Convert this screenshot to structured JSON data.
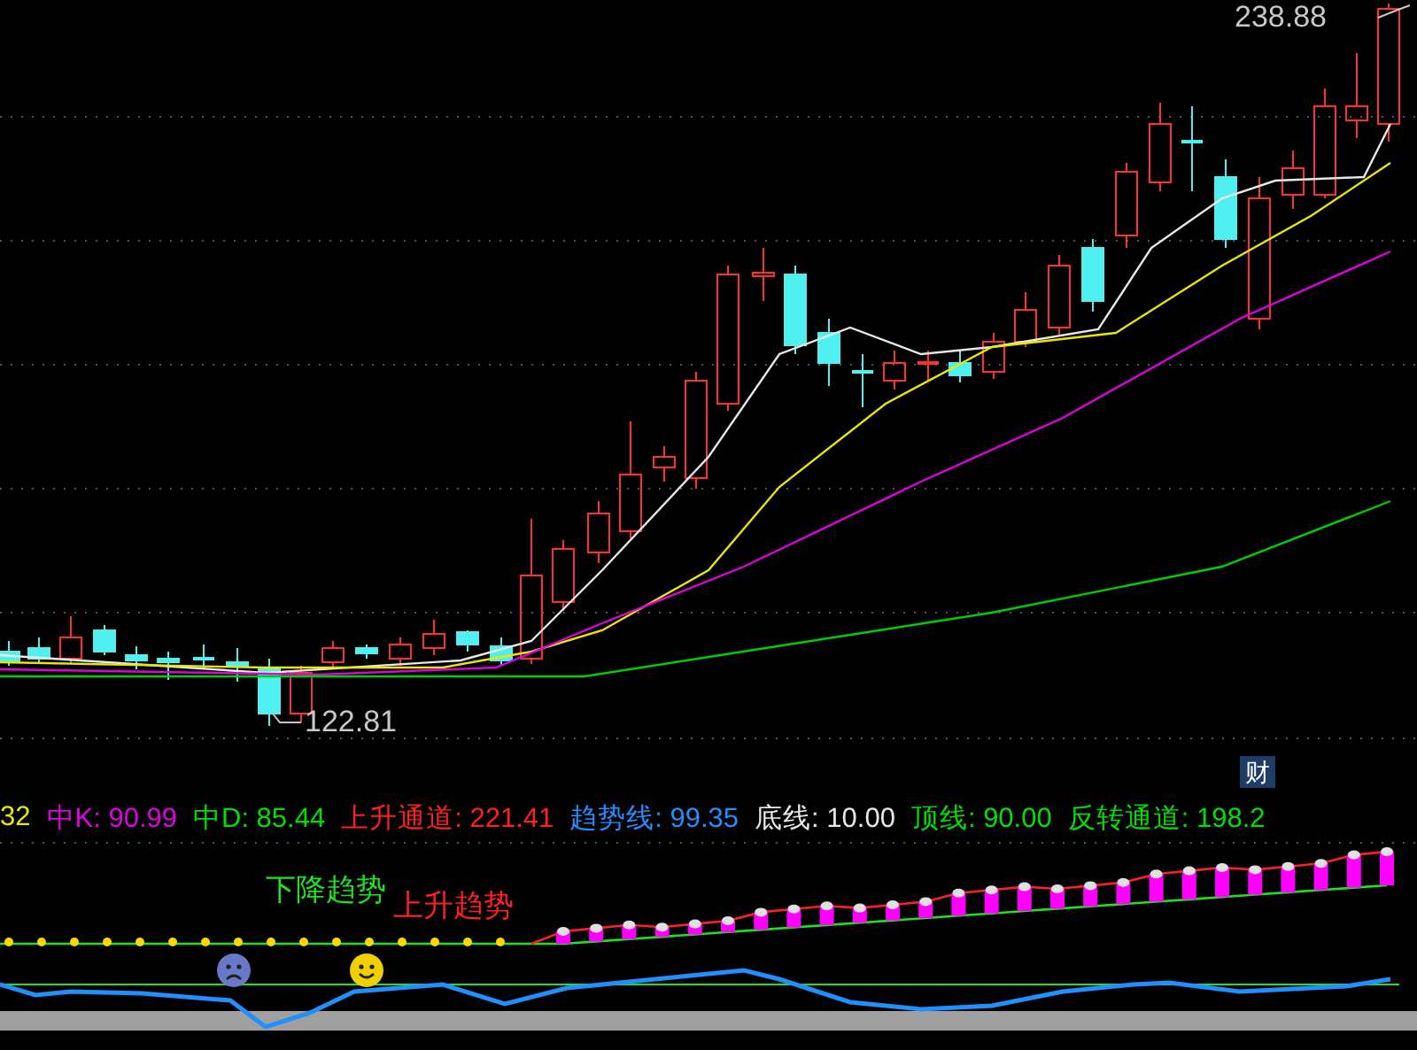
{
  "price_labels": {
    "high": "238.88",
    "low": "122.81"
  },
  "badge": "财",
  "legend": [
    {
      "text": "32",
      "color": "#e8e800"
    },
    {
      "text": "中K: 90.99",
      "color": "#e000e0"
    },
    {
      "text": "中D: 85.44",
      "color": "#00e000"
    },
    {
      "text": "上升通道: 221.41",
      "color": "#ff2020"
    },
    {
      "text": "趋势线: 99.35",
      "color": "#2090ff"
    },
    {
      "text": "底线: 10.00",
      "color": "#e8e8e8"
    },
    {
      "text": "顶线: 90.00",
      "color": "#00e000"
    },
    {
      "text": "反转通道: 198.2",
      "color": "#00e000"
    }
  ],
  "signals": [
    {
      "text": "下降趋势",
      "kind": "down"
    },
    {
      "text": "上升趋势",
      "kind": "up"
    }
  ]
}
